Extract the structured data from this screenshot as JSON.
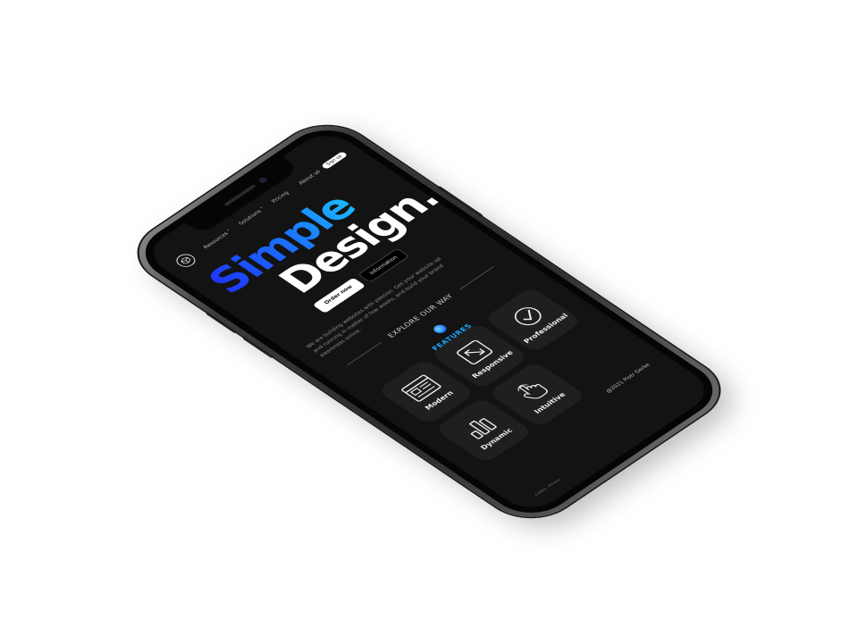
{
  "nav": {
    "items": [
      {
        "label": "Resources ˅"
      },
      {
        "label": "Solutions ˅"
      },
      {
        "label": "Pricing"
      }
    ],
    "about_label": "About us",
    "signup_label": "Sign up"
  },
  "hero": {
    "title_part1": "Simple",
    "title_part2": "Design.",
    "subtitle": "We are building websites with passion. Get your website up and running in matter of few weeks, and build your brand awareness online.",
    "primary_button": "Order now",
    "secondary_button": "Information"
  },
  "explore": {
    "label": "EXPLORE OUR WAY"
  },
  "features": {
    "label": "FEATURES",
    "cards": [
      {
        "label": "Modern",
        "icon": "browser-window-icon"
      },
      {
        "label": "Responsive",
        "icon": "resize-arrow-icon"
      },
      {
        "label": "Professional",
        "icon": "checkmark-circle-icon"
      },
      {
        "label": "Dynamic",
        "icon": "bar-chart-icon"
      },
      {
        "label": "Intuitive",
        "icon": "touch-hand-icon"
      }
    ]
  },
  "footer": {
    "copyright": "@2021 Piotr Gerke",
    "mini": "Credits · Privacy"
  },
  "colors": {
    "accent_start": "#1d35ff",
    "accent_end": "#1ee0ff",
    "screen_bg": "#131313",
    "card_bg": "#1f1f1f"
  }
}
